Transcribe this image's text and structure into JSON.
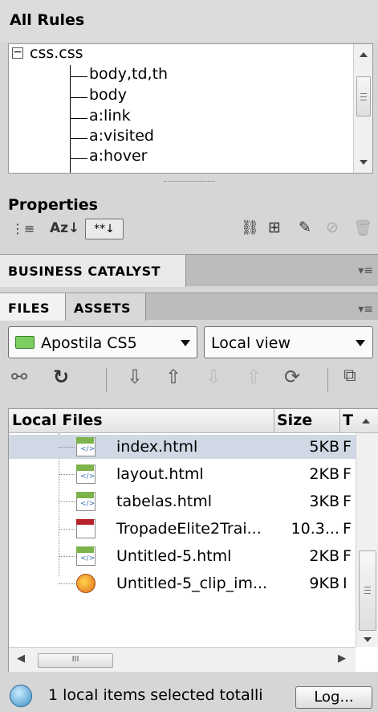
{
  "all_rules": {
    "title": "All Rules",
    "root": "css.css",
    "rules": [
      "body,td,th",
      "body",
      "a:link",
      "a:visited",
      "a:hover"
    ]
  },
  "properties": {
    "title": "Properties",
    "az_label": "Az↓",
    "active_view_label": "**↓"
  },
  "business_catalyst": {
    "tab": "BUSINESS CATALYST"
  },
  "files_panel": {
    "tabs": [
      "FILES",
      "ASSETS"
    ],
    "site_select": "Apostila CS5",
    "view_select": "Local view",
    "columns": {
      "name": "Local Files",
      "size": "Size",
      "type": "T"
    },
    "files": [
      {
        "name": "index.html",
        "size": "5KB",
        "type": "F",
        "icon": "html-file-icon",
        "selected": true
      },
      {
        "name": "layout.html",
        "size": "2KB",
        "type": "F",
        "icon": "html-file-icon",
        "selected": false
      },
      {
        "name": "tabelas.html",
        "size": "3KB",
        "type": "F",
        "icon": "html-file-icon",
        "selected": false
      },
      {
        "name": "TropadeElite2Trai...",
        "size": "10.3...",
        "type": "F",
        "icon": "text-file-icon",
        "selected": false
      },
      {
        "name": "Untitled-5.html",
        "size": "2KB",
        "type": "F",
        "icon": "html-file-icon",
        "selected": false
      },
      {
        "name": "Untitled-5_clip_im...",
        "size": "9KB",
        "type": "I",
        "icon": "image-file-icon",
        "selected": false
      }
    ],
    "hscroll_thumb": "III"
  },
  "status": {
    "text": "1 local items selected totalli",
    "log_button": "Log..."
  }
}
